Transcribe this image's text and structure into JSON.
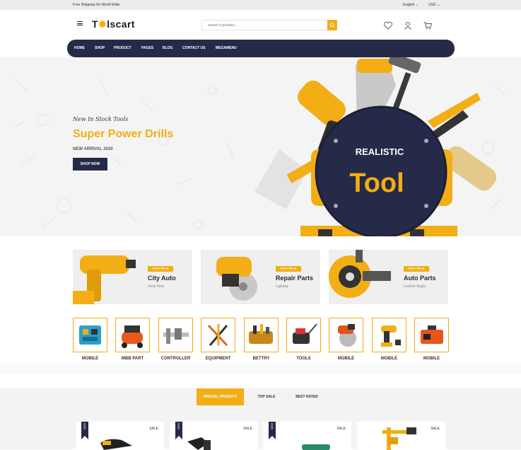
{
  "topbar": {
    "shipping": "Free Shipping On World Wide",
    "language": "English",
    "currency": "USD"
  },
  "header": {
    "logo_prefix": "T",
    "logo_suffix": "lscart",
    "search_placeholder": "search a product..."
  },
  "nav": {
    "items": [
      "HOME",
      "SHOP",
      "PRODUCT",
      "PAGES",
      "BLOG",
      "CONTACT US",
      "MEGAMENU"
    ]
  },
  "hero": {
    "subtitle": "New In Stock Tools",
    "title": "Super Power Drills",
    "new_arrival": "NEW ARRIVAL 2020",
    "button": "SHOP NOW",
    "badge_top": "REALISTIC",
    "badge_main": "Tool"
  },
  "banners": [
    {
      "button": "View More",
      "title": "City Auto",
      "subtitle": "Shop Now"
    },
    {
      "button": "View More",
      "title": "Repair Parts",
      "subtitle": "Lighting"
    },
    {
      "button": "View More",
      "title": "Auto Parts",
      "subtitle": "Leather Bagfs"
    }
  ],
  "categories": [
    "MOBILE",
    "MBB PART",
    "CONTROLLER",
    "EQUIPMENT",
    "BETTRY",
    "TOOLS",
    "MOBILE",
    "MOBILE",
    "MOBILE"
  ],
  "product_tabs": [
    "SPECIAL PRODUCT",
    "TOP SALE",
    "BEST RATED"
  ],
  "products": [
    {
      "badge": "NEW",
      "sale": "SALE"
    },
    {
      "badge": "NEW",
      "sale": "SALE"
    },
    {
      "badge": "NEW",
      "sale": "SALE"
    },
    {
      "badge": "",
      "sale": "SALE"
    }
  ],
  "colors": {
    "accent": "#f2ae14",
    "navy": "#262a49"
  }
}
